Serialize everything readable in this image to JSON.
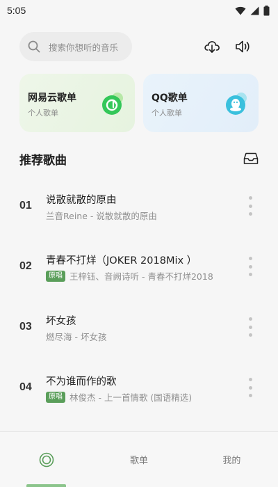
{
  "status_bar": {
    "time": "5:05"
  },
  "search": {
    "placeholder": "搜索你想听的音乐"
  },
  "cards": [
    {
      "title": "网易云歌单",
      "subtitle": "个人歌单",
      "accent": "#34c759"
    },
    {
      "title": "QQ歌单",
      "subtitle": "个人歌单",
      "accent": "#3ac0dd"
    }
  ],
  "section": {
    "title": "推荐歌曲"
  },
  "songs": [
    {
      "number": "01",
      "title": "说散就散的原由",
      "artist": "兰音Reine - 说散就散的原由",
      "badge": ""
    },
    {
      "number": "02",
      "title": "青春不打烊（JOKER 2018Mix ）",
      "artist": "王梓钰、音阙诗听 - 青春不打烊2018",
      "badge": "原唱"
    },
    {
      "number": "03",
      "title": "坏女孩",
      "artist": "燃尽海 - 坏女孩",
      "badge": ""
    },
    {
      "number": "04",
      "title": "不为谁而作的歌",
      "artist": "林俊杰 - 上一首情歌 (国语精选)",
      "badge": "原唱"
    }
  ],
  "nav": {
    "items": [
      {
        "label": "",
        "icon": "music-disc-icon",
        "active": true
      },
      {
        "label": "歌单"
      },
      {
        "label": "我的"
      }
    ]
  },
  "colors": {
    "accent_green": "#5a9e5a",
    "active_indicator": "#8bc48b"
  }
}
